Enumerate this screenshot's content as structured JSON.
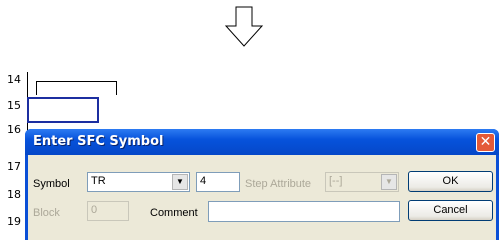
{
  "ladder": {
    "row_numbers": [
      "14",
      "15",
      "16",
      "17",
      "18",
      "19"
    ]
  },
  "dialog": {
    "title": "Enter SFC Symbol",
    "close_glyph": "✕",
    "symbol_label": "Symbol",
    "symbol_value": "TR",
    "number_value": "4",
    "step_attribute_label": "Step Attribute",
    "step_attribute_value": "[--]",
    "ok_label": "OK",
    "block_label": "Block",
    "block_value": "0",
    "comment_label": "Comment",
    "comment_value": "",
    "cancel_label": "Cancel"
  },
  "colors": {
    "title_bar": "#0753dc",
    "dialog_body": "#ece9d8",
    "cursor_border": "#1c2ea0",
    "close_button": "#e45a38"
  }
}
